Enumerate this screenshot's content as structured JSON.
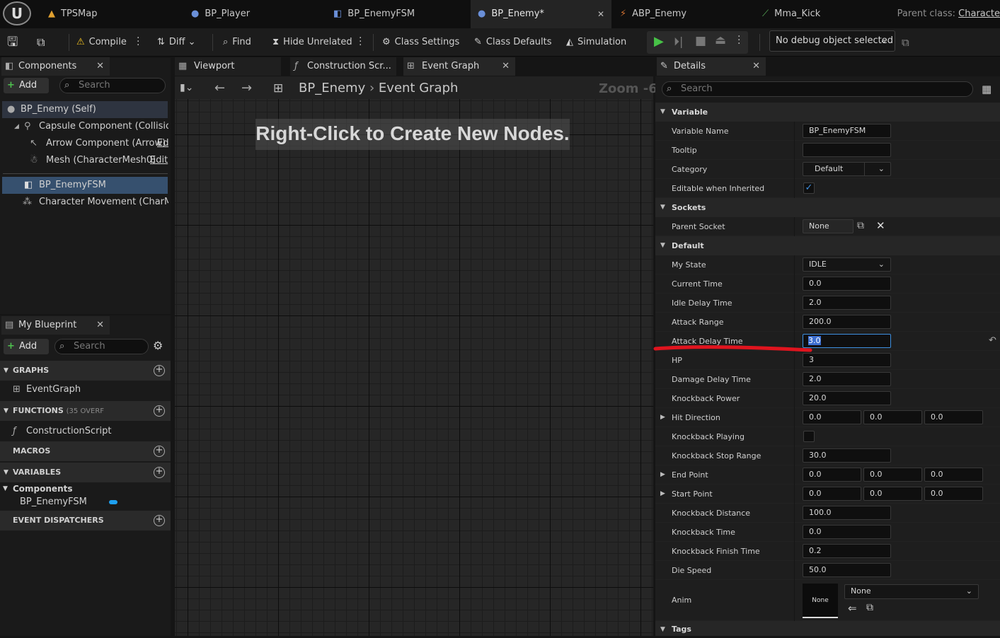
{
  "title_tabs": [
    {
      "label": "TPSMap",
      "icon": "level-icon"
    },
    {
      "label": "BP_Player",
      "icon": "pawn-icon"
    },
    {
      "label": "BP_EnemyFSM",
      "icon": "blueprint-component-icon"
    },
    {
      "label": "BP_Enemy*",
      "icon": "pawn-icon"
    },
    {
      "label": "ABP_Enemy",
      "icon": "anim-blueprint-icon"
    },
    {
      "label": "Mma_Kick",
      "icon": "anim-sequence-icon"
    }
  ],
  "parent_class_label": "Parent class:",
  "parent_class_value": "Characte",
  "toolbar": {
    "compile": "Compile",
    "diff": "Diff",
    "find": "Find",
    "hide_unrelated": "Hide Unrelated",
    "class_settings": "Class Settings",
    "class_defaults": "Class Defaults",
    "simulation": "Simulation",
    "debug_object": "No debug object selected"
  },
  "components_panel": {
    "title": "Components",
    "add": "Add",
    "search_placeholder": "Search",
    "items": [
      {
        "label": "BP_Enemy (Self)"
      },
      {
        "label": "Capsule Component (CollisionCy"
      },
      {
        "label": "Arrow Component (Arrow)",
        "link": "Ed"
      },
      {
        "label": "Mesh (CharacterMesh0)",
        "link": "Edit"
      },
      {
        "label": "BP_EnemyFSM"
      },
      {
        "label": "Character Movement (CharMove"
      }
    ]
  },
  "editor_tabs": {
    "viewport": "Viewport",
    "construction": "Construction Scr...",
    "event_graph": "Event Graph"
  },
  "graph": {
    "breadcrumb_root": "BP_Enemy",
    "breadcrumb_leaf": "Event Graph",
    "zoom": "Zoom -6",
    "hint": "Right-Click to Create New Nodes."
  },
  "my_blueprint": {
    "title": "My Blueprint",
    "add": "Add",
    "search_placeholder": "Search",
    "graphs_header": "GRAPHS",
    "event_graph": "EventGraph",
    "functions_header": "FUNCTIONS",
    "functions_count": "(35 OVERF",
    "construction_script": "ConstructionScript",
    "macros_header": "MACROS",
    "variables_header": "VARIABLES",
    "components_group": "Components",
    "component_var": "BP_EnemyFSM",
    "dispatchers_header": "EVENT DISPATCHERS"
  },
  "details": {
    "title": "Details",
    "search_placeholder": "Search",
    "sections": {
      "variable": "Variable",
      "sockets": "Sockets",
      "default": "Default",
      "tags": "Tags"
    },
    "variable_name_label": "Variable Name",
    "variable_name": "BP_EnemyFSM",
    "tooltip_label": "Tooltip",
    "tooltip": "",
    "category_label": "Category",
    "category": "Default",
    "editable_label": "Editable when Inherited",
    "editable_checked": true,
    "parent_socket_label": "Parent Socket",
    "parent_socket": "None",
    "rows": [
      {
        "label": "My State",
        "value": "IDLE"
      },
      {
        "label": "Current Time",
        "value": "0.0"
      },
      {
        "label": "Idle Delay Time",
        "value": "2.0"
      },
      {
        "label": "Attack Range",
        "value": "200.0"
      },
      {
        "label": "Attack Delay Time",
        "value": "3.0"
      },
      {
        "label": "HP",
        "value": "3"
      },
      {
        "label": "Damage Delay Time",
        "value": "2.0"
      },
      {
        "label": "Knockback Power",
        "value": "20.0"
      },
      {
        "label": "Hit Direction",
        "x": "0.0",
        "y": "0.0",
        "z": "0.0"
      },
      {
        "label": "Knockback Playing",
        "checked": false
      },
      {
        "label": "Knockback Stop Range",
        "value": "30.0"
      },
      {
        "label": "End Point",
        "x": "0.0",
        "y": "0.0",
        "z": "0.0"
      },
      {
        "label": "Start Point",
        "x": "0.0",
        "y": "0.0",
        "z": "0.0"
      },
      {
        "label": "Knockback Distance",
        "value": "100.0"
      },
      {
        "label": "Knockback Time",
        "value": "0.0"
      },
      {
        "label": "Knockback Finish Time",
        "value": "0.2"
      },
      {
        "label": "Die Speed",
        "value": "50.0"
      }
    ],
    "anim_label": "Anim",
    "anim_thumb": "None",
    "anim_value": "None"
  },
  "colors": {
    "accent_blue": "#3d8fe0",
    "selection": "#36506e",
    "annotation_red": "#e0141e",
    "play_green": "#47c247"
  }
}
